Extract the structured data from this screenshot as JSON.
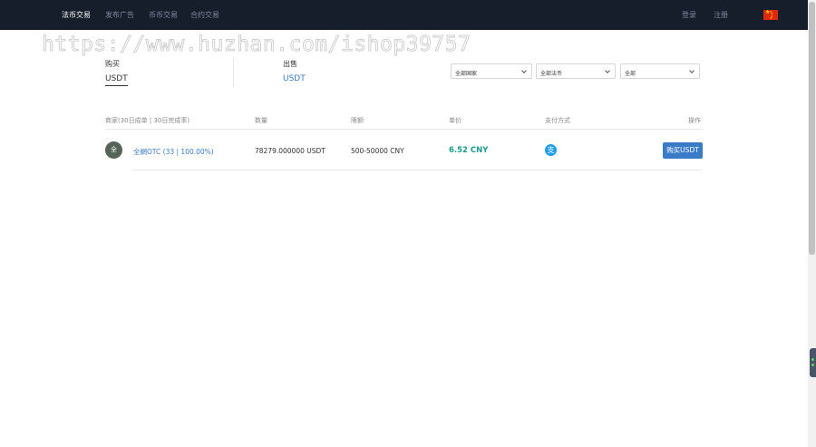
{
  "nav": {
    "items": [
      "法币交易",
      "发布广告",
      "币币交易",
      "合约交易"
    ],
    "login": "登录",
    "register": "注册"
  },
  "watermark": "https://www.huzhan.com/ishop39757",
  "tabs": {
    "buy_label": "购买",
    "buy_coin": "USDT",
    "sell_label": "出售",
    "sell_coin": "USDT"
  },
  "filters": {
    "country": "全部国家",
    "currency": "全部法币",
    "payment": "全部"
  },
  "table": {
    "headers": {
      "merchant": "商家(30日成单 | 30日完成率)",
      "quantity": "数量",
      "limit": "限额",
      "price": "单价",
      "payment": "支付方式",
      "action": "操作"
    },
    "rows": [
      {
        "avatar": "全",
        "merchant": "全網OTC (33 | 100.00%)",
        "quantity": "78279.000000 USDT",
        "limit": "500-50000 CNY",
        "price": "6.52 CNY",
        "payment_icon": "alipay-icon",
        "action": "购买USDT"
      }
    ]
  },
  "colors": {
    "topbar": "#161d2b",
    "accent": "#3a7bc8",
    "price": "#1a9a8e",
    "alipay": "#1e9de8"
  }
}
